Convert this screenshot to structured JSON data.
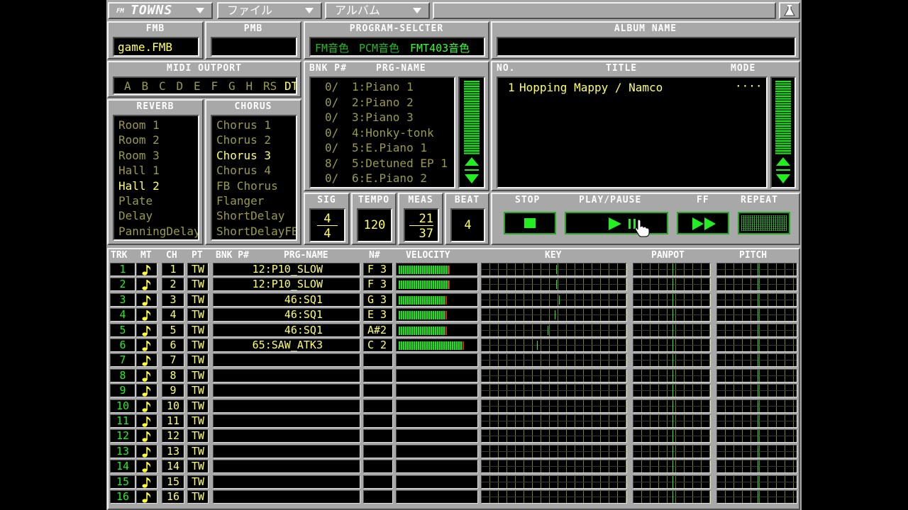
{
  "menubar": {
    "logo_small": "FM",
    "logo": "TOWNS",
    "file": "ファイル",
    "album": "アルバム"
  },
  "fmb": {
    "header": "FMB",
    "value": "game.FMB"
  },
  "pmb": {
    "header": "PMB",
    "value": ""
  },
  "program_selecter": {
    "header": "PROGRAM-SELCTER",
    "fm": "FM音色",
    "pcm": "PCM音色",
    "fmt": "FMT403音色"
  },
  "album_name": {
    "header": "ALBUM NAME",
    "value": ""
  },
  "midi_outport": {
    "header": "MIDI OUTPORT",
    "ports": [
      "A",
      "B",
      "C",
      "D",
      "E",
      "F",
      "G",
      "H",
      "RS",
      "DT"
    ],
    "active": "DT"
  },
  "reverb": {
    "header": "REVERB",
    "items": [
      "Room 1",
      "Room 2",
      "Room 3",
      "Hall 1",
      "Hall 2",
      "Plate",
      "Delay",
      "PanningDelay"
    ],
    "selected": "Hall 2"
  },
  "chorus": {
    "header": "CHORUS",
    "items": [
      "Chorus 1",
      "Chorus 2",
      "Chorus 3",
      "Chorus 4",
      "FB Chorus",
      "Flanger",
      "ShortDelay",
      "ShortDelayFB"
    ],
    "selected": "Chorus 3"
  },
  "program_list": {
    "col_bnk": "BNK P#",
    "col_name": "PRG-NAME",
    "rows": [
      {
        "bnk": "0/",
        "prg": "1:Piano 1"
      },
      {
        "bnk": "0/",
        "prg": "2:Piano 2"
      },
      {
        "bnk": "0/",
        "prg": "3:Piano 3"
      },
      {
        "bnk": "0/",
        "prg": "4:Honky-tonk"
      },
      {
        "bnk": "0/",
        "prg": "5:E.Piano 1"
      },
      {
        "bnk": "8/",
        "prg": "5:Detuned EP 1"
      },
      {
        "bnk": "0/",
        "prg": "6:E.Piano 2"
      }
    ]
  },
  "playlist": {
    "col_no": "NO.",
    "col_title": "TITLE",
    "col_mode": "MODE",
    "rows": [
      {
        "no": "1",
        "title": "Hopping Mappy / Namco",
        "mode": "····"
      }
    ]
  },
  "sig": {
    "header": "SIG",
    "num": "4",
    "den": "4"
  },
  "tempo": {
    "header": "TEMPO",
    "value": "120"
  },
  "meas": {
    "header": "MEAS",
    "current": "21",
    "total": "37"
  },
  "beat": {
    "header": "BEAT",
    "value": "4"
  },
  "transport": {
    "stop": "STOP",
    "play_pause": "PLAY/PAUSE",
    "ff": "FF",
    "repeat": "REPEAT"
  },
  "tracks_header": {
    "trk": "TRK",
    "mt": "MT",
    "ch": "CH",
    "pt": "PT",
    "bnk": "BNK P#",
    "prg": "PRG-NAME",
    "note": "N#",
    "velocity": "VELOCITY",
    "key": "KEY",
    "panpot": "PANPOT",
    "pitch": "PITCH"
  },
  "tracks": [
    {
      "trk": "1",
      "ch": "1",
      "pt": "TW",
      "prg": "12:P10_SLOW",
      "note": "F 3",
      "velocity": 0.64,
      "key": 0.51,
      "pan": 0.5,
      "pitch": 0.5
    },
    {
      "trk": "2",
      "ch": "2",
      "pt": "TW",
      "prg": "12:P10_SLOW",
      "note": "F 3",
      "velocity": 0.64,
      "key": 0.51,
      "pan": 0.5,
      "pitch": 0.5
    },
    {
      "trk": "3",
      "ch": "3",
      "pt": "TW",
      "prg": "46:SQ1",
      "note": "G 3",
      "velocity": 0.6,
      "key": 0.53,
      "pan": 0.5,
      "pitch": 0.5
    },
    {
      "trk": "4",
      "ch": "4",
      "pt": "TW",
      "prg": "46:SQ1",
      "note": "E 3",
      "velocity": 0.6,
      "key": 0.5,
      "pan": 0.5,
      "pitch": 0.5
    },
    {
      "trk": "5",
      "ch": "5",
      "pt": "TW",
      "prg": "46:SQ1",
      "note": "A#2",
      "velocity": 0.6,
      "key": 0.45,
      "pan": 0.5,
      "pitch": 0.5
    },
    {
      "trk": "6",
      "ch": "6",
      "pt": "TW",
      "prg": "65:SAW_ATK3",
      "note": "C 2",
      "velocity": 0.82,
      "key": 0.38,
      "pan": 0.5,
      "pitch": 0.5
    },
    {
      "trk": "7",
      "ch": "7",
      "pt": "TW",
      "prg": "",
      "note": "",
      "velocity": 0,
      "key": null,
      "pan": 0.5,
      "pitch": 0.5
    },
    {
      "trk": "8",
      "ch": "8",
      "pt": "TW",
      "prg": "",
      "note": "",
      "velocity": 0,
      "key": null,
      "pan": 0.5,
      "pitch": 0.5
    },
    {
      "trk": "9",
      "ch": "9",
      "pt": "TW",
      "prg": "",
      "note": "",
      "velocity": 0,
      "key": null,
      "pan": 0.5,
      "pitch": 0.5
    },
    {
      "trk": "10",
      "ch": "10",
      "pt": "TW",
      "prg": "",
      "note": "",
      "velocity": 0,
      "key": null,
      "pan": 0.5,
      "pitch": 0.5
    },
    {
      "trk": "11",
      "ch": "11",
      "pt": "TW",
      "prg": "",
      "note": "",
      "velocity": 0,
      "key": null,
      "pan": 0.5,
      "pitch": 0.5
    },
    {
      "trk": "12",
      "ch": "12",
      "pt": "TW",
      "prg": "",
      "note": "",
      "velocity": 0,
      "key": null,
      "pan": 0.5,
      "pitch": 0.5
    },
    {
      "trk": "13",
      "ch": "13",
      "pt": "TW",
      "prg": "",
      "note": "",
      "velocity": 0,
      "key": null,
      "pan": 0.5,
      "pitch": 0.5
    },
    {
      "trk": "14",
      "ch": "14",
      "pt": "TW",
      "prg": "",
      "note": "",
      "velocity": 0,
      "key": null,
      "pan": 0.5,
      "pitch": 0.5
    },
    {
      "trk": "15",
      "ch": "15",
      "pt": "TW",
      "prg": "",
      "note": "",
      "velocity": 0,
      "key": null,
      "pan": 0.5,
      "pitch": 0.5
    },
    {
      "trk": "16",
      "ch": "16",
      "pt": "TW",
      "prg": "",
      "note": "",
      "velocity": 0,
      "key": null,
      "pan": 0.5,
      "pitch": 0.5
    }
  ],
  "colors": {
    "panel": "#a8a8a8",
    "lcd_bg": "#000000",
    "text_yellow": "#ffff66",
    "text_dim": "#9a9a48",
    "text_green": "#22ee22"
  }
}
